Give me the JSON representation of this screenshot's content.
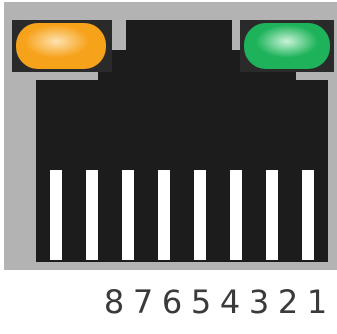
{
  "connector": {
    "type": "RJ45 port",
    "leds": [
      {
        "name": "left-led",
        "color": "#f7a21b",
        "highlight": "#fde2b0"
      },
      {
        "name": "right-led",
        "color": "#1eb35a",
        "highlight": "#c9f3d8"
      }
    ],
    "pin_numbers": [
      "8",
      "7",
      "6",
      "5",
      "4",
      "3",
      "2",
      "1"
    ],
    "colors": {
      "housing": "#b3b3b3",
      "cavity": "#1c1c1c",
      "contacts": "#ffffff"
    }
  }
}
